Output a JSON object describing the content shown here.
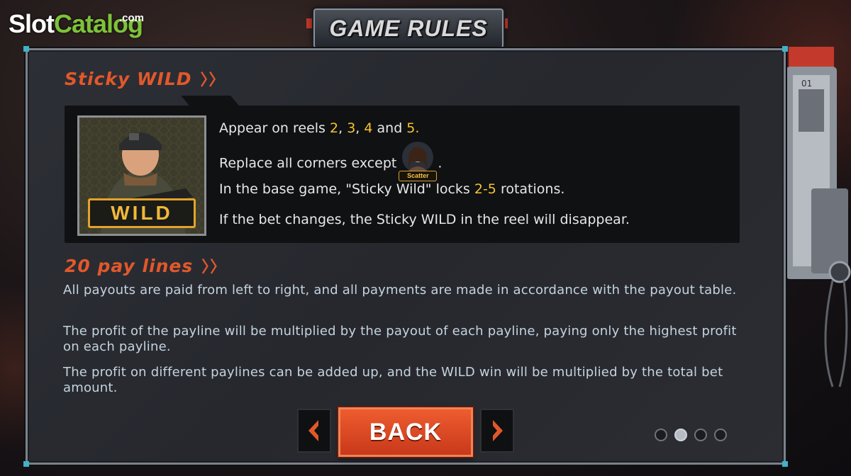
{
  "watermark": {
    "part1": "Slot",
    "part2": "Catalog",
    "suffix": ".com"
  },
  "header": {
    "title": "GAME RULES"
  },
  "sticky_wild": {
    "title": "Sticky WILD",
    "chevron": "〉〉",
    "symbol_label": "WILD",
    "line1": {
      "prefix": "Appear on reels ",
      "n1": "2",
      "sep1": ", ",
      "n2": "3",
      "sep2": ", ",
      "n3": "4",
      "and": " and ",
      "n4": "5",
      "end": "."
    },
    "line2": {
      "text": "Replace all corners except",
      "icon_label": "Scatter",
      "end": "."
    },
    "line3": {
      "prefix": "In the base game, \"Sticky Wild\" locks ",
      "range": "2-5",
      "suffix": " rotations."
    },
    "line4": "If the bet changes, the Sticky WILD in the reel will disappear."
  },
  "paylines": {
    "title": "20 pay lines",
    "chevron": "〉〉",
    "paragraphs": [
      "All payouts are paid from left to right, and all payments are made in accordance with the payout table.",
      "The profit of the payline will be multiplied by the payout of each payline, paying only the highest profit on each payline.",
      "The profit on different paylines can be added up, and the WILD win will be multiplied by the total bet amount."
    ]
  },
  "footer": {
    "back_label": "BACK"
  },
  "pagination": {
    "pages": 4,
    "current": 2
  },
  "colors": {
    "accent": "#e2582a",
    "highlight": "#f4c430",
    "body_text": "#c4d3dd",
    "button": "#e04a22"
  },
  "icons": [
    "arrow-left-icon",
    "arrow-right-icon",
    "wild-soldier-icon",
    "scatter-icon",
    "chevron-right-icon"
  ]
}
